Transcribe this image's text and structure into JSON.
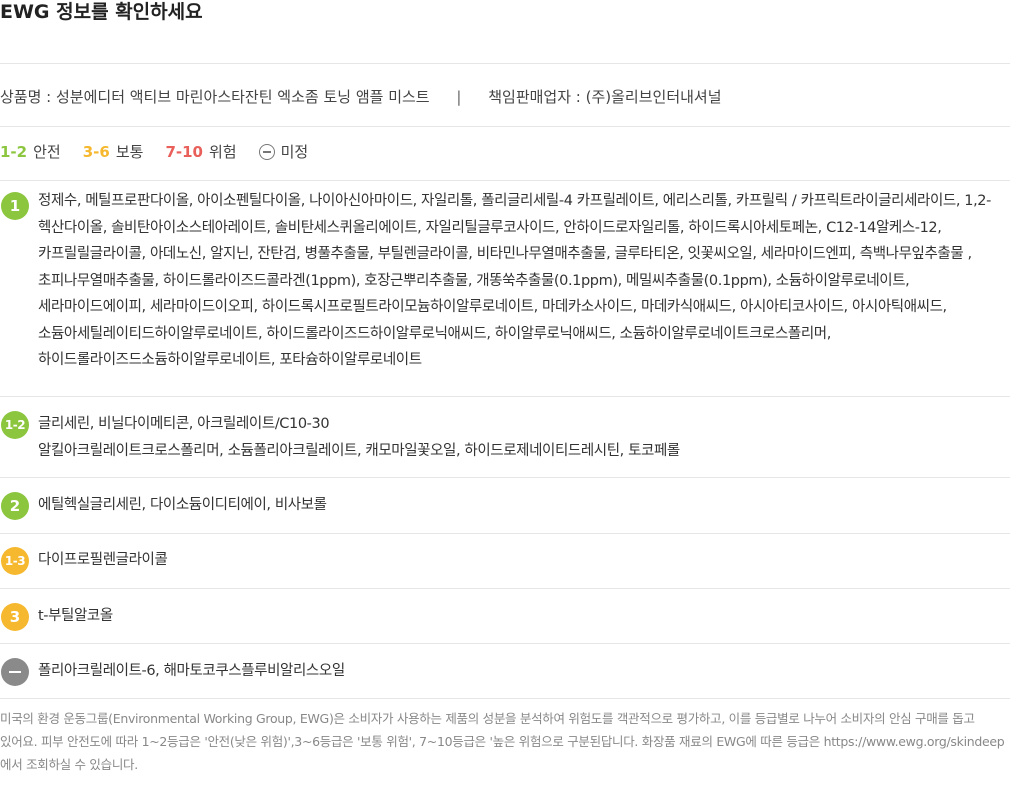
{
  "title": "EWG 정보를 확인하세요",
  "product": {
    "name": "상품명 : 성분에디터 액티브 마린아스타잔틴 엑소좀 토닝 앰플 미스트",
    "separator": "|",
    "seller": "책임판매업자 : (주)올리브인터내셔널"
  },
  "legend": [
    {
      "grade": "1-2",
      "label": "안전",
      "color": "#8cc63f"
    },
    {
      "grade": "3-6",
      "label": "보통",
      "color": "#f5b82e"
    },
    {
      "grade": "7-10",
      "label": "위험",
      "color": "#e9605b"
    },
    {
      "grade": "",
      "label": "미정",
      "icon": "minus-circle-icon"
    }
  ],
  "rows": [
    {
      "badge": "1",
      "color": "#8cc63f",
      "text": "정제수, 메틸프로판다이올, 아이소펜틸다이올, 나이아신아마이드, 자일리톨, 폴리글리세릴-4 카프릴레이트, 에리스리톨, 카프릴릭 / 카프릭트라이글리세라이드, 1,2-헥산다이올, 솔비탄아이소스테아레이트, 솔비탄세스퀴올리에이트, 자일리틸글루코사이드, 안하이드로자일리톨, 하이드록시아세토페논, C12-14알케스-12, 카프릴릴글라이콜, 아데노신, 알지닌, 잔탄검, 병풀추출물, 부틸렌글라이콜, 비타민나무열매추출물, 글루타티온, 잇꽃씨오일, 세라마이드엔피, 측백나무잎추출물 , 초피나무열매추출물, 하이드롤라이즈드콜라겐(1ppm), 호장근뿌리추출물, 개똥쑥추출물(0.1ppm), 메밀씨추출물(0.1ppm), 소듐하이알루로네이트, 세라마이드에이피, 세라마이드이오피, 하이드록시프로필트라이모늄하이알루로네이트, 마데카소사이드, 마데카식애씨드, 아시아티코사이드, 아시아틱애씨드, 소듐아세틸레이티드하이알루로네이트, 하이드롤라이즈드하이알루로닉애씨드, 하이알루로닉애씨드, 소듐하이알루로네이트크로스폴리머, 하이드롤라이즈드소듐하이알루로네이트, 포타슘하이알루로네이트"
    },
    {
      "badge": "1-2",
      "color": "#8cc63f",
      "text": "글리세린, 비닐다이메티콘, 아크릴레이트/C10-30\n알킬아크릴레이트크로스폴리머, 소듐폴리아크릴레이트, 캐모마일꽃오일, 하이드로제네이티드레시틴, 토코페롤"
    },
    {
      "badge": "2",
      "color": "#8cc63f",
      "text": "에틸헥실글리세린, 다이소듐이디티에이, 비사보롤"
    },
    {
      "badge": "1-3",
      "color": "#f5b82e",
      "text": "다이프로필렌글라이콜"
    },
    {
      "badge": "3",
      "color": "#f5b82e",
      "text": "t-부틸알코올"
    },
    {
      "badge": "",
      "icon": "minus-icon",
      "color": "#8a8a8a",
      "text": "폴리아크릴레이트-6, 해마토코쿠스플루비알리스오일"
    }
  ],
  "note": "미국의 환경 운동그룹(Environmental Working Group, EWG)은 소비자가 사용하는 제품의 성분을 분석하여 위험도를 객관적으로 평가하고, 이를 등급별로 나누어 소비자의 안심 구매를 돕고 있어요. 피부 안전도에 따라 1~2등급은 '안전(낮은 위험)',3~6등급은 '보통 위험', 7~10등급은 '높은 위험으로 구분된답니다. 화장품 재료의 EWG에 따른 등급은 https://www.ewg.org/skindeep 에서 조회하실 수 있습니다."
}
